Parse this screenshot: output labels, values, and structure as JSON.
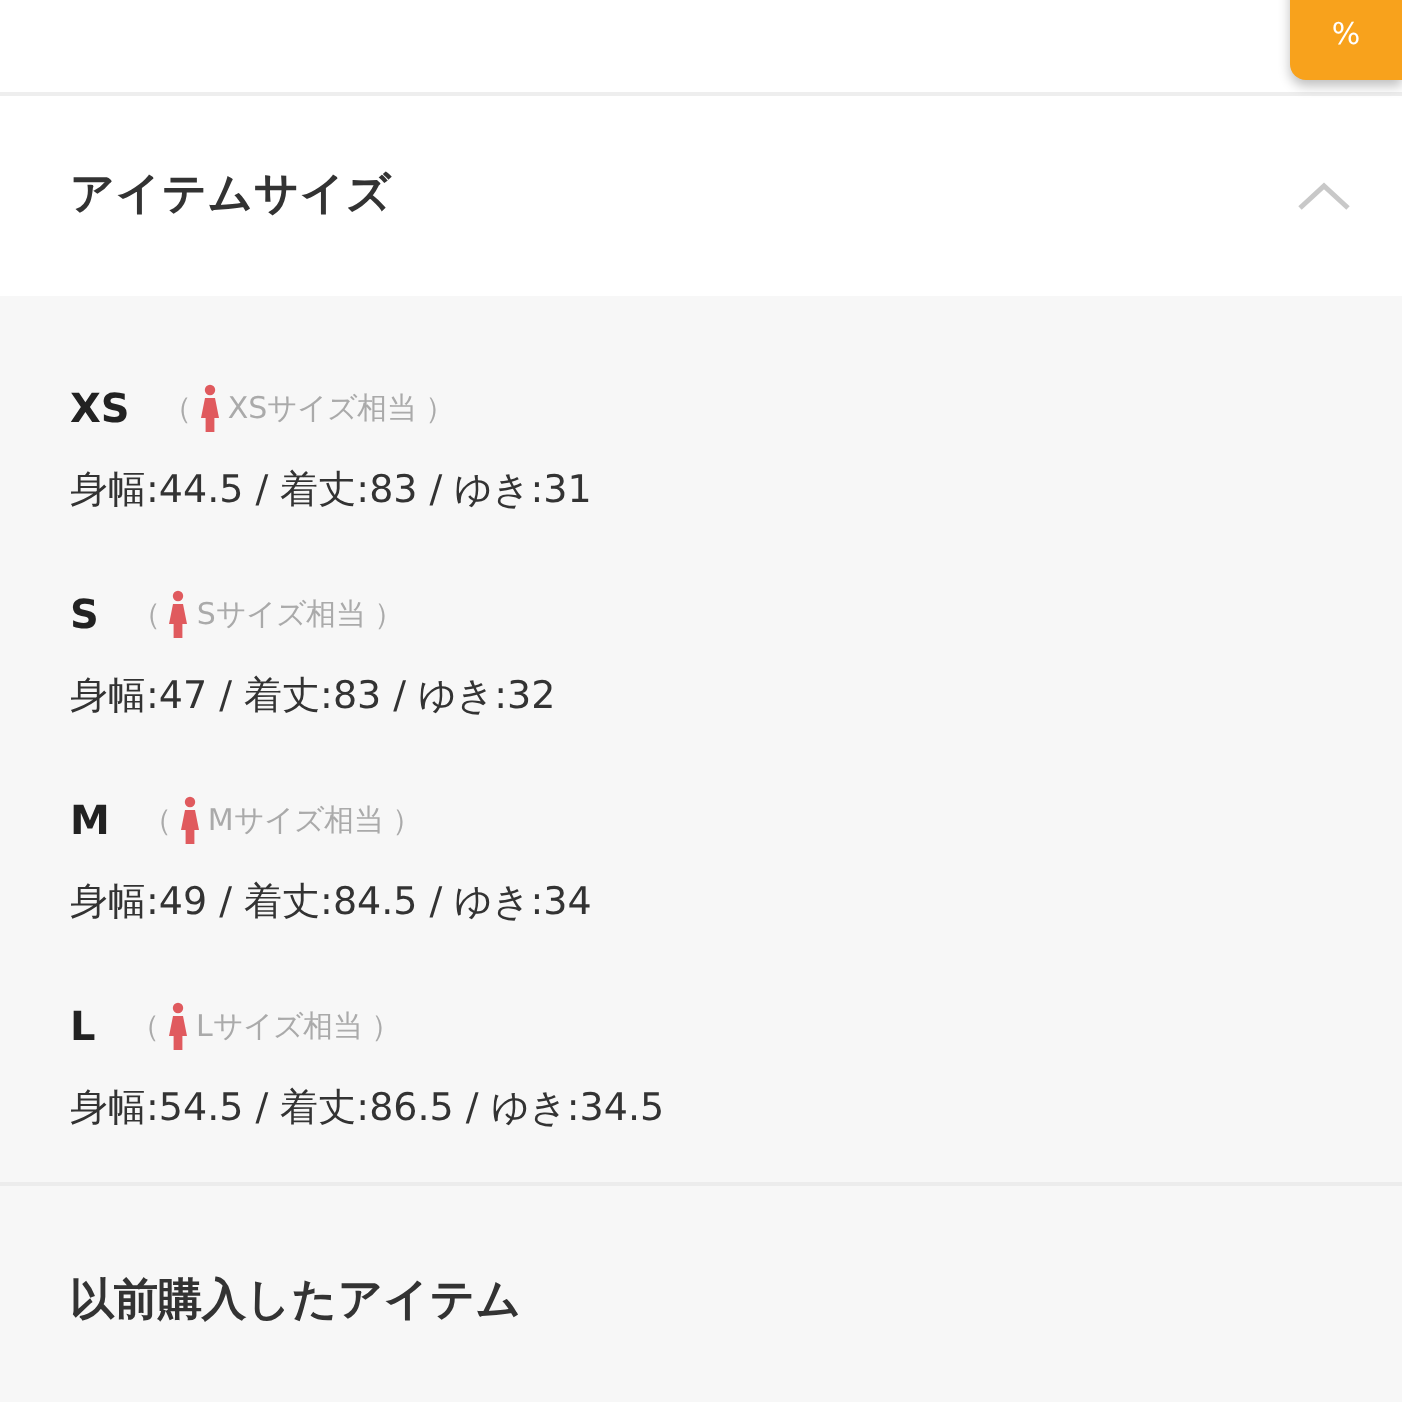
{
  "badge": {
    "lines": [
      "%"
    ]
  },
  "size_section": {
    "title": "アイテムサイズ",
    "expanded": true,
    "sizes": [
      {
        "label": "XS",
        "open": "（",
        "equivalent": "XSサイズ相当",
        "close": "）",
        "measurements": "身幅:44.5 / 着丈:83 / ゆき:31"
      },
      {
        "label": "S",
        "open": "（",
        "equivalent": "Sサイズ相当",
        "close": "）",
        "measurements": "身幅:47 / 着丈:83 / ゆき:32"
      },
      {
        "label": "M",
        "open": "（",
        "equivalent": "Mサイズ相当",
        "close": "）",
        "measurements": "身幅:49 / 着丈:84.5 / ゆき:34"
      },
      {
        "label": "L",
        "open": "（",
        "equivalent": "Lサイズ相当",
        "close": "）",
        "measurements": "身幅:54.5 / 着丈:86.5 / ゆき:34.5"
      }
    ]
  },
  "previous_section": {
    "title": "以前購入したアイテム"
  }
}
